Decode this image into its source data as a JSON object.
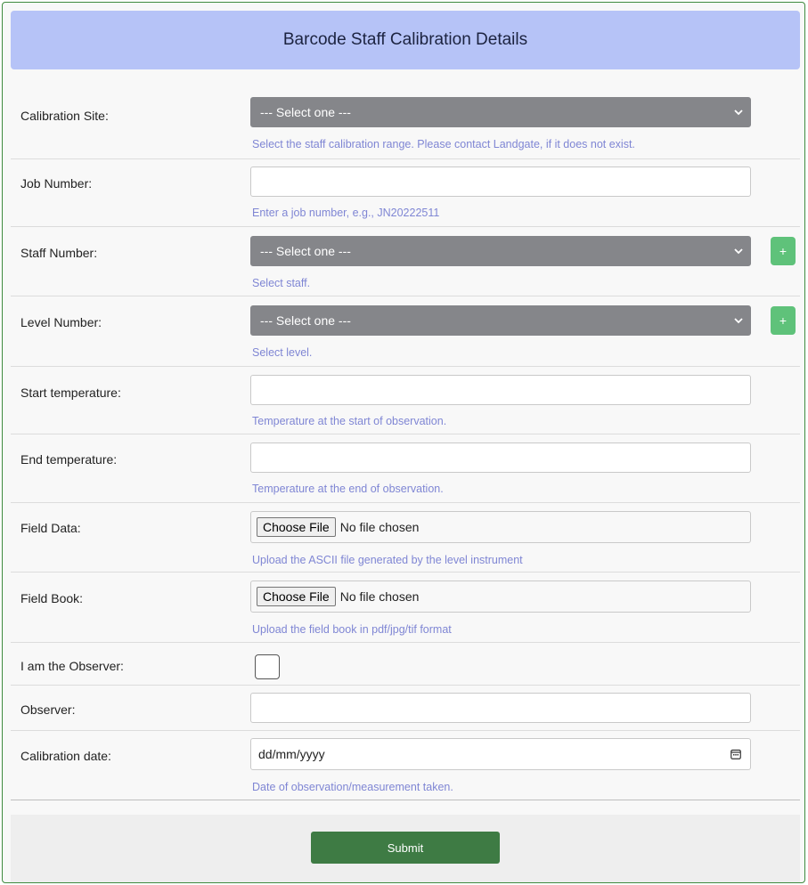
{
  "header": {
    "title": "Barcode Staff Calibration Details"
  },
  "fields": {
    "calibration_site": {
      "label": "Calibration Site:",
      "selected": "--- Select one ---",
      "help": "Select the staff calibration range. Please contact Landgate, if it does not exist."
    },
    "job_number": {
      "label": "Job Number:",
      "value": "",
      "help": "Enter a job number, e.g., JN20222511"
    },
    "staff_number": {
      "label": "Staff Number:",
      "selected": "--- Select one ---",
      "help": "Select staff.",
      "add_label": "+"
    },
    "level_number": {
      "label": "Level Number:",
      "selected": "--- Select one ---",
      "help": "Select level.",
      "add_label": "+"
    },
    "start_temperature": {
      "label": "Start temperature:",
      "value": "",
      "help": "Temperature at the start of observation."
    },
    "end_temperature": {
      "label": "End temperature:",
      "value": "",
      "help": "Temperature at the end of observation."
    },
    "field_data": {
      "label": "Field Data:",
      "button": "Choose File",
      "status": "No file chosen",
      "help": "Upload the ASCII file generated by the level instrument"
    },
    "field_book": {
      "label": "Field Book:",
      "button": "Choose File",
      "status": "No file chosen",
      "help": "Upload the field book in pdf/jpg/tif format"
    },
    "observer_checkbox": {
      "label": "I am the Observer:",
      "checked": false
    },
    "observer": {
      "label": "Observer:",
      "value": ""
    },
    "calibration_date": {
      "label": "Calibration date:",
      "placeholder": "dd/mm/yyyy",
      "help": "Date of observation/measurement taken."
    }
  },
  "submit": {
    "label": "Submit"
  },
  "colors": {
    "header_bg": "#b6c3f7",
    "select_bg": "#85868a",
    "help_text": "#7f86d4",
    "add_button": "#5fc27a",
    "submit_button": "#3e7b44",
    "border": "#3e8a3e"
  }
}
